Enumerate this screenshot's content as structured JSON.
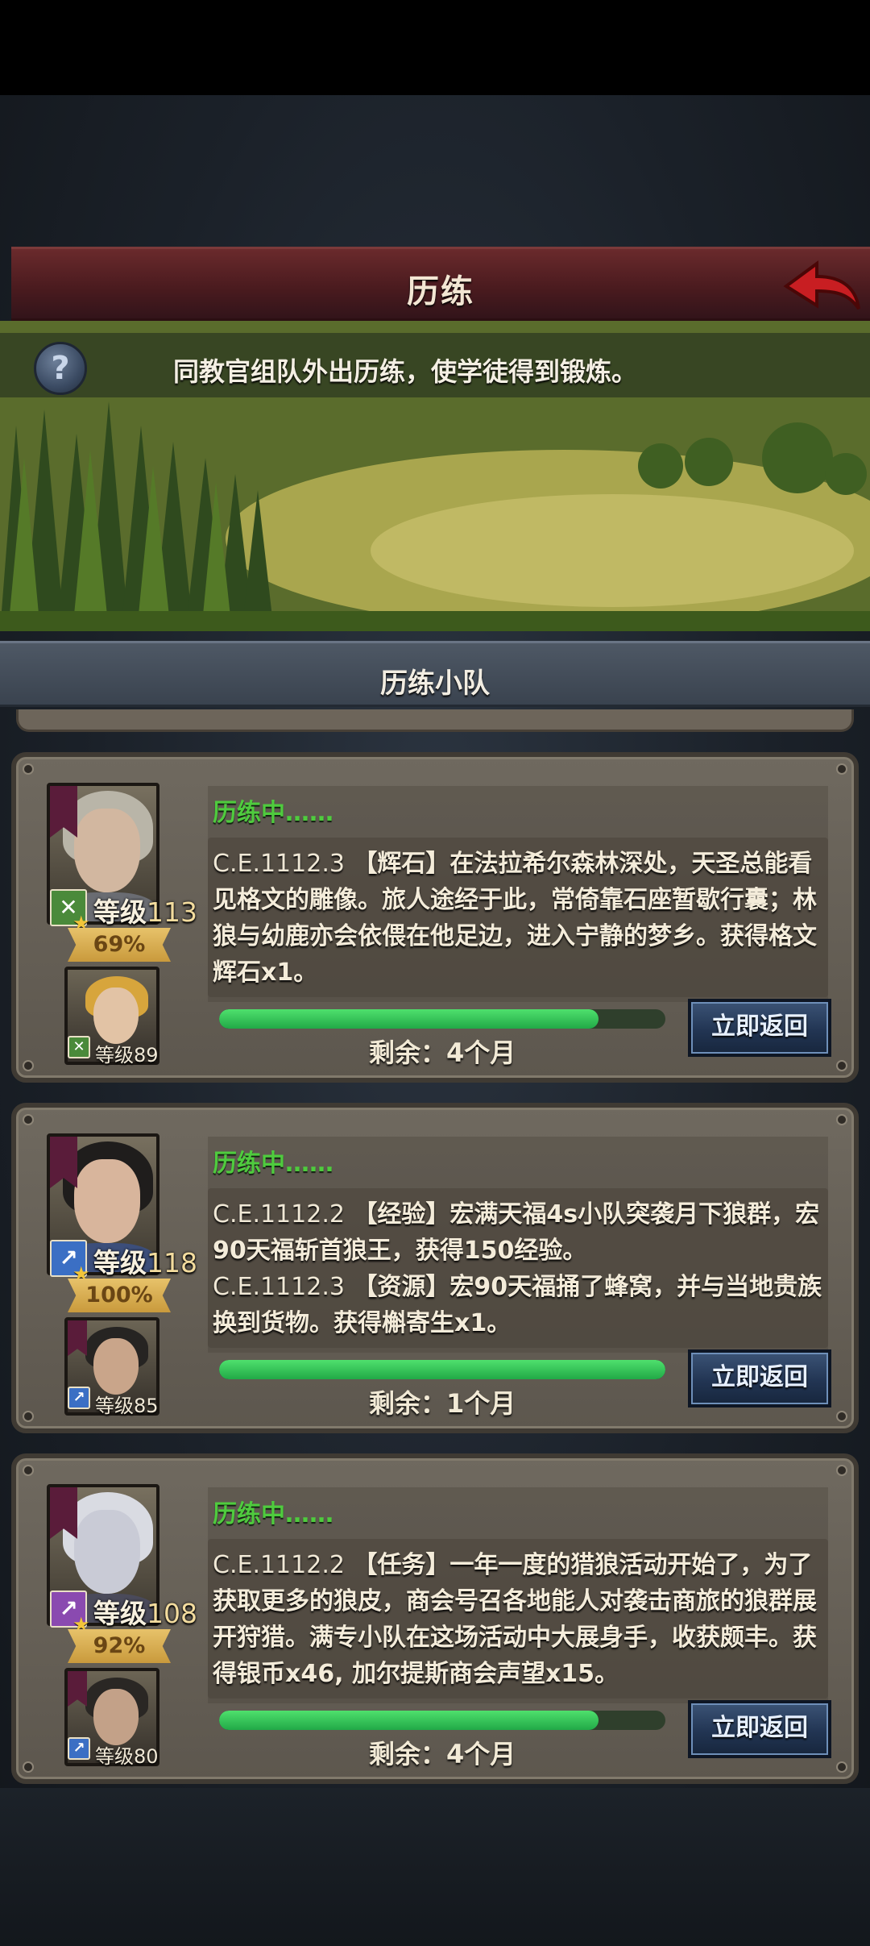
{
  "header": {
    "title": "历练"
  },
  "banner": {
    "description": "同教官组队外出历练，使学徒得到锻炼。"
  },
  "section": {
    "title": "历练小队"
  },
  "return_label": "立即返回",
  "teams": [
    {
      "status": "历练中……",
      "main_level_label": "等级",
      "main_level_value": "113",
      "main_progress_text": "69%",
      "sub_level_text": "等级89",
      "log_date": "C.E.1112.3",
      "log_text": "【辉石】在法拉希尔森林深处，天圣总能看见格文的雕像。旅人途经于此，常倚靠石座暂歇行囊；林狼与幼鹿亦会依偎在他足边，进入宁静的梦乡。获得格文辉石x1。",
      "remaining": "剩余：4个月",
      "progress": 0.85
    },
    {
      "status": "历练中……",
      "main_level_label": "等级",
      "main_level_value": "118",
      "main_progress_text": "100%",
      "sub_level_text": "等级85",
      "log_date": "C.E.1112.2",
      "log_text": "【经验】宏满天福4s小队突袭月下狼群，宏90天福斩首狼王，获得150经验。",
      "log_date_2": "C.E.1112.3",
      "log_text_2": "【资源】宏90天福捅了蜂窝，并与当地贵族换到货物。获得槲寄生x1。",
      "remaining": "剩余：1个月",
      "progress": 1.0
    },
    {
      "status": "历练中……",
      "main_level_label": "等级",
      "main_level_value": "108",
      "main_progress_text": "92%",
      "sub_level_text": "等级80",
      "log_date": "C.E.1112.2",
      "log_text": "【任务】一年一度的猎狼活动开始了，为了获取更多的狼皮，商会号召各地能人对袭击商旅的狼群展开狩猎。满专小队在这场活动中大展身手，收获颇丰。获得银币x46, 加尔提斯商会声望x15。",
      "remaining": "剩余：4个月",
      "progress": 0.85
    }
  ],
  "colors": {
    "status_green": "#4fcb3e",
    "progress_green": "#31c056",
    "title_red": "#5a1f24",
    "button_blue": "#223553"
  },
  "icons": [
    "back-arrow-icon",
    "help-icon",
    "tree-banner-icon",
    "sword-class-icon",
    "spear-class-icon",
    "staff-class-icon",
    "star-icon"
  ]
}
